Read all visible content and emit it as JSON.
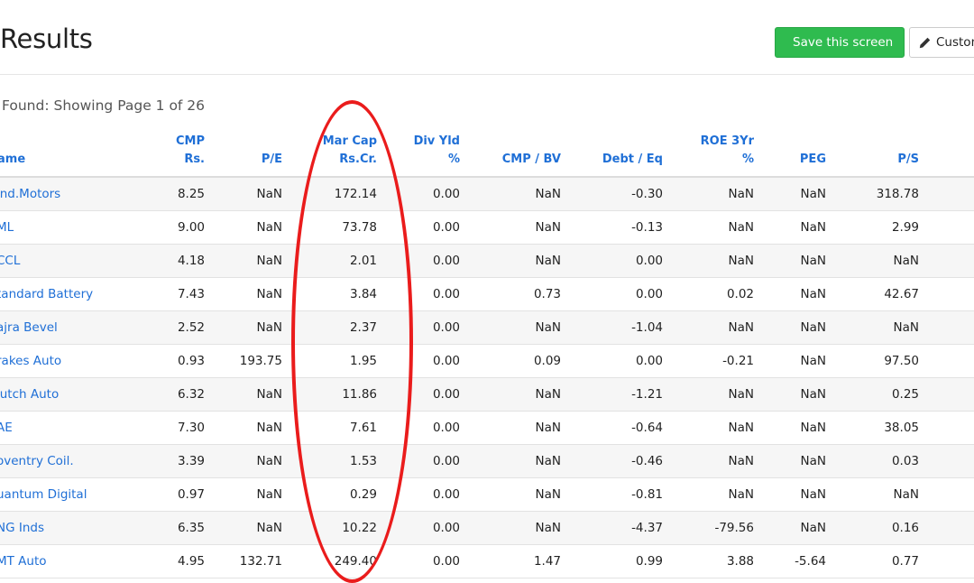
{
  "header": {
    "title": "Results",
    "save_button_label": "Save this screen",
    "customize_button_label": "Custon"
  },
  "summary": {
    "found_text": "Found: Showing Page 1 of 26"
  },
  "table": {
    "columns": [
      {
        "key": "name",
        "line1": "",
        "line2": "ame"
      },
      {
        "key": "cmp",
        "line1": "CMP",
        "line2": "Rs."
      },
      {
        "key": "pe",
        "line1": "",
        "line2": "P/E"
      },
      {
        "key": "mcap",
        "line1": "Mar Cap",
        "line2": "Rs.Cr."
      },
      {
        "key": "divyld",
        "line1": "Div Yld",
        "line2": "%"
      },
      {
        "key": "cmpbv",
        "line1": "",
        "line2": "CMP / BV"
      },
      {
        "key": "debteq",
        "line1": "",
        "line2": "Debt / Eq"
      },
      {
        "key": "roe",
        "line1": "ROE 3Yr",
        "line2": "%"
      },
      {
        "key": "peg",
        "line1": "",
        "line2": "PEG"
      },
      {
        "key": "ps",
        "line1": "",
        "line2": "P/S"
      }
    ],
    "rows": [
      [
        "ind.Motors",
        "8.25",
        "NaN",
        "172.14",
        "0.00",
        "NaN",
        "-0.30",
        "NaN",
        "NaN",
        "318.78"
      ],
      [
        "ML",
        "9.00",
        "NaN",
        "73.78",
        "0.00",
        "NaN",
        "-0.13",
        "NaN",
        "NaN",
        "2.99"
      ],
      [
        "CCL",
        "4.18",
        "NaN",
        "2.01",
        "0.00",
        "NaN",
        "0.00",
        "NaN",
        "NaN",
        "NaN"
      ],
      [
        "tandard Battery",
        "7.43",
        "NaN",
        "3.84",
        "0.00",
        "0.73",
        "0.00",
        "0.02",
        "NaN",
        "42.67"
      ],
      [
        "ajra Bevel",
        "2.52",
        "NaN",
        "2.37",
        "0.00",
        "NaN",
        "-1.04",
        "NaN",
        "NaN",
        "NaN"
      ],
      [
        "rakes Auto",
        "0.93",
        "193.75",
        "1.95",
        "0.00",
        "0.09",
        "0.00",
        "-0.21",
        "NaN",
        "97.50"
      ],
      [
        "lutch Auto",
        "6.32",
        "NaN",
        "11.86",
        "0.00",
        "NaN",
        "-1.21",
        "NaN",
        "NaN",
        "0.25"
      ],
      [
        "AE",
        "7.30",
        "NaN",
        "7.61",
        "0.00",
        "NaN",
        "-0.64",
        "NaN",
        "NaN",
        "38.05"
      ],
      [
        "oventry Coil.",
        "3.39",
        "NaN",
        "1.53",
        "0.00",
        "NaN",
        "-0.46",
        "NaN",
        "NaN",
        "0.03"
      ],
      [
        "uantum Digital",
        "0.97",
        "NaN",
        "0.29",
        "0.00",
        "NaN",
        "-0.81",
        "NaN",
        "NaN",
        "NaN"
      ],
      [
        "NG Inds",
        "6.35",
        "NaN",
        "10.22",
        "0.00",
        "NaN",
        "-4.37",
        "-79.56",
        "NaN",
        "0.16"
      ],
      [
        "MT Auto",
        "4.95",
        "132.71",
        "249.40",
        "0.00",
        "1.47",
        "0.99",
        "3.88",
        "-5.64",
        "0.77"
      ]
    ]
  },
  "annotation": {
    "color": "#ea1c1c",
    "highlighted_column": "mcap"
  }
}
